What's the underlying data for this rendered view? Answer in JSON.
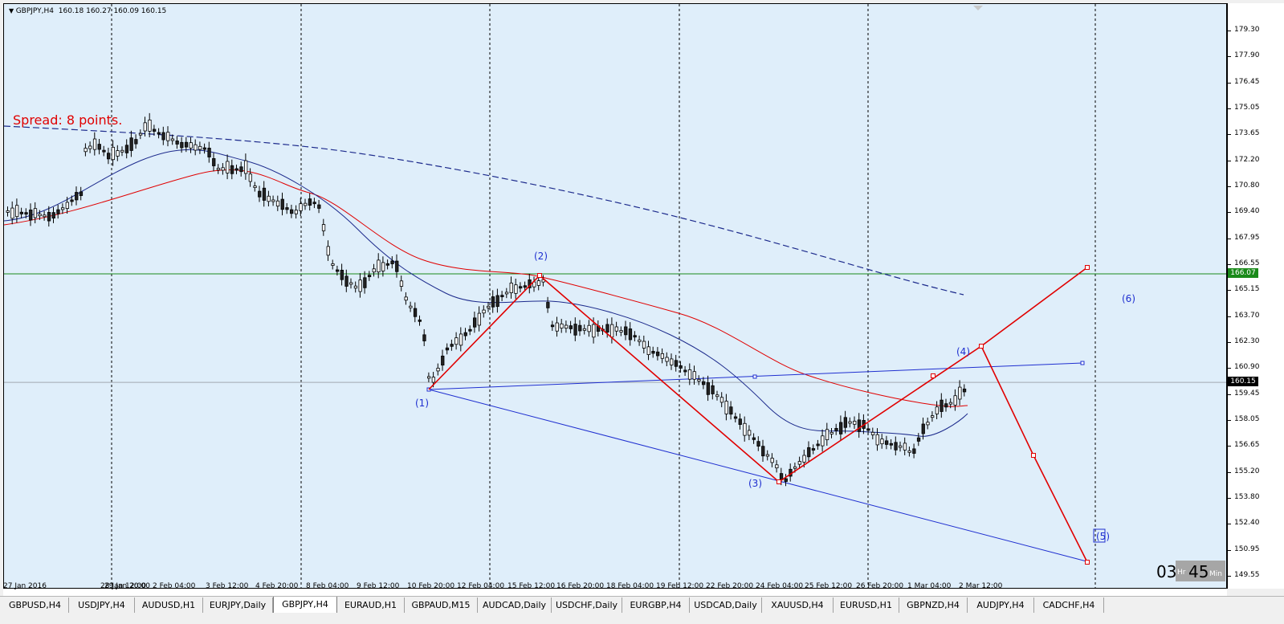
{
  "chart": {
    "symbol_info": "GBPJPY,H4  160.18 160.27 160.09 160.15",
    "spread_text": "Spread: 8 points.",
    "price_ticks": [
      "179.30",
      "177.90",
      "176.45",
      "175.05",
      "173.65",
      "172.20",
      "170.80",
      "169.40",
      "167.95",
      "166.55",
      "165.15",
      "163.70",
      "162.30",
      "160.90",
      "159.45",
      "158.05",
      "156.65",
      "155.20",
      "153.80",
      "152.40",
      "150.95",
      "149.55"
    ],
    "horizontal_line_price": "166.07",
    "current_price": "160.15",
    "time_ticks": [
      "27 Jan 2016",
      "28 Jan 12:00",
      "29 Jan 20:00",
      "2 Feb 04:00",
      "3 Feb 12:00",
      "4 Feb 20:00",
      "8 Feb 04:00",
      "9 Feb 12:00",
      "10 Feb 20:00",
      "12 Feb 04:00",
      "15 Feb 12:00",
      "16 Feb 20:00",
      "18 Feb 04:00",
      "19 Feb 12:00",
      "22 Feb 20:00",
      "24 Feb 04:00",
      "25 Feb 12:00",
      "26 Feb 20:00",
      "1 Mar 04:00",
      "2 Mar 12:00"
    ],
    "wave_labels": [
      "(1)",
      "(2)",
      "(3)",
      "(4)",
      "(5)",
      "(6)"
    ],
    "timer": {
      "left": "03",
      "unit_a": "Hr",
      "right": "45",
      "unit_b": "Min"
    },
    "colors": {
      "background": "#dfeefa",
      "zigzag": "#e00000",
      "channel": "#1f2fd0",
      "horizontal_line": "#1a8a1a",
      "ma_fast": "#1c2a8c",
      "ma_slow": "#e00000",
      "ma_long": "#1c2a8c"
    }
  },
  "tabs": [
    {
      "label": "GBPUSD,H4",
      "active": false
    },
    {
      "label": "USDJPY,H4",
      "active": false
    },
    {
      "label": "AUDUSD,H1",
      "active": false
    },
    {
      "label": "EURJPY,Daily",
      "active": false
    },
    {
      "label": "GBPJPY,H4",
      "active": true
    },
    {
      "label": "EURAUD,H1",
      "active": false
    },
    {
      "label": "GBPAUD,M15",
      "active": false
    },
    {
      "label": "AUDCAD,Daily",
      "active": false
    },
    {
      "label": "USDCHF,Daily",
      "active": false
    },
    {
      "label": "EURGBP,H4",
      "active": false
    },
    {
      "label": "USDCAD,Daily",
      "active": false
    },
    {
      "label": "XAUUSD,H4",
      "active": false
    },
    {
      "label": "EURUSD,H1",
      "active": false
    },
    {
      "label": "GBPNZD,H4",
      "active": false
    },
    {
      "label": "AUDJPY,H4",
      "active": false
    },
    {
      "label": "CADCHF,H4",
      "active": false
    }
  ]
}
